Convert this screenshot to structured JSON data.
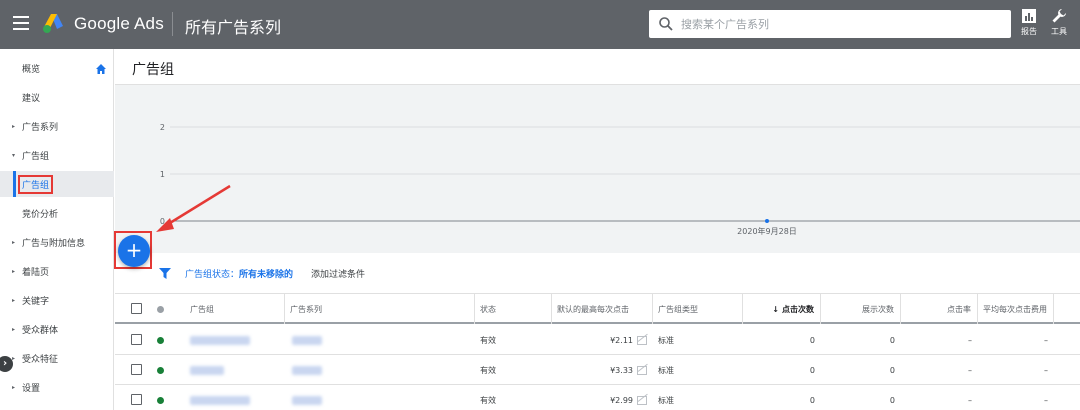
{
  "header": {
    "brand": "Google Ads",
    "campaign_title": "所有广告系列",
    "search_placeholder": "搜索某个广告系列",
    "reports_label": "报告",
    "tools_label": "工具"
  },
  "sidebar": {
    "items": [
      {
        "label": "概览",
        "arrow": ""
      },
      {
        "label": "建议",
        "arrow": ""
      },
      {
        "label": "广告系列",
        "arrow": "▸"
      },
      {
        "label": "广告组",
        "arrow": "▾"
      },
      {
        "label": "广告组",
        "arrow": ""
      },
      {
        "label": "竞价分析",
        "arrow": ""
      },
      {
        "label": "广告与附加信息",
        "arrow": "▸"
      },
      {
        "label": "着陆页",
        "arrow": "▸"
      },
      {
        "label": "关键字",
        "arrow": "▸"
      },
      {
        "label": "受众群体",
        "arrow": "▸"
      },
      {
        "label": "受众特征",
        "arrow": "▸"
      },
      {
        "label": "设置",
        "arrow": "▸"
      }
    ],
    "collapse_glyph": "›"
  },
  "main": {
    "page_title": "广告组",
    "fab_label": "+",
    "filter_prefix": "广告组状态：",
    "filter_value": "所有未移除的",
    "add_filter": "添加过滤条件"
  },
  "chart_data": {
    "type": "line",
    "y_ticks": [
      "2",
      "1",
      "0"
    ],
    "ylim": [
      0,
      2
    ],
    "x_label_date": "2020年9月28日",
    "points": [
      {
        "x": "2020年9月28日",
        "y": 0
      }
    ]
  },
  "table": {
    "headers": [
      "广告组",
      "广告系列",
      "状态",
      "默认的最高每次点击",
      "广告组类型",
      "点击次数",
      "展示次数",
      "点击率",
      "平均每次点击费用"
    ],
    "sort_arrow": "↓",
    "rows": [
      {
        "status": "有效",
        "bid": "¥2.11",
        "type": "标准",
        "clicks": "0",
        "impressions": "0",
        "ctr": "–",
        "cpc": "–"
      },
      {
        "status": "有效",
        "bid": "¥3.33",
        "type": "标准",
        "clicks": "0",
        "impressions": "0",
        "ctr": "–",
        "cpc": "–"
      },
      {
        "status": "有效",
        "bid": "¥2.99",
        "type": "标准",
        "clicks": "0",
        "impressions": "0",
        "ctr": "–",
        "cpc": "–"
      }
    ]
  },
  "colors": {
    "topbar": "#5f6368",
    "accent": "#1a73e8",
    "highlight": "#e53935",
    "status_enabled": "#188038"
  }
}
